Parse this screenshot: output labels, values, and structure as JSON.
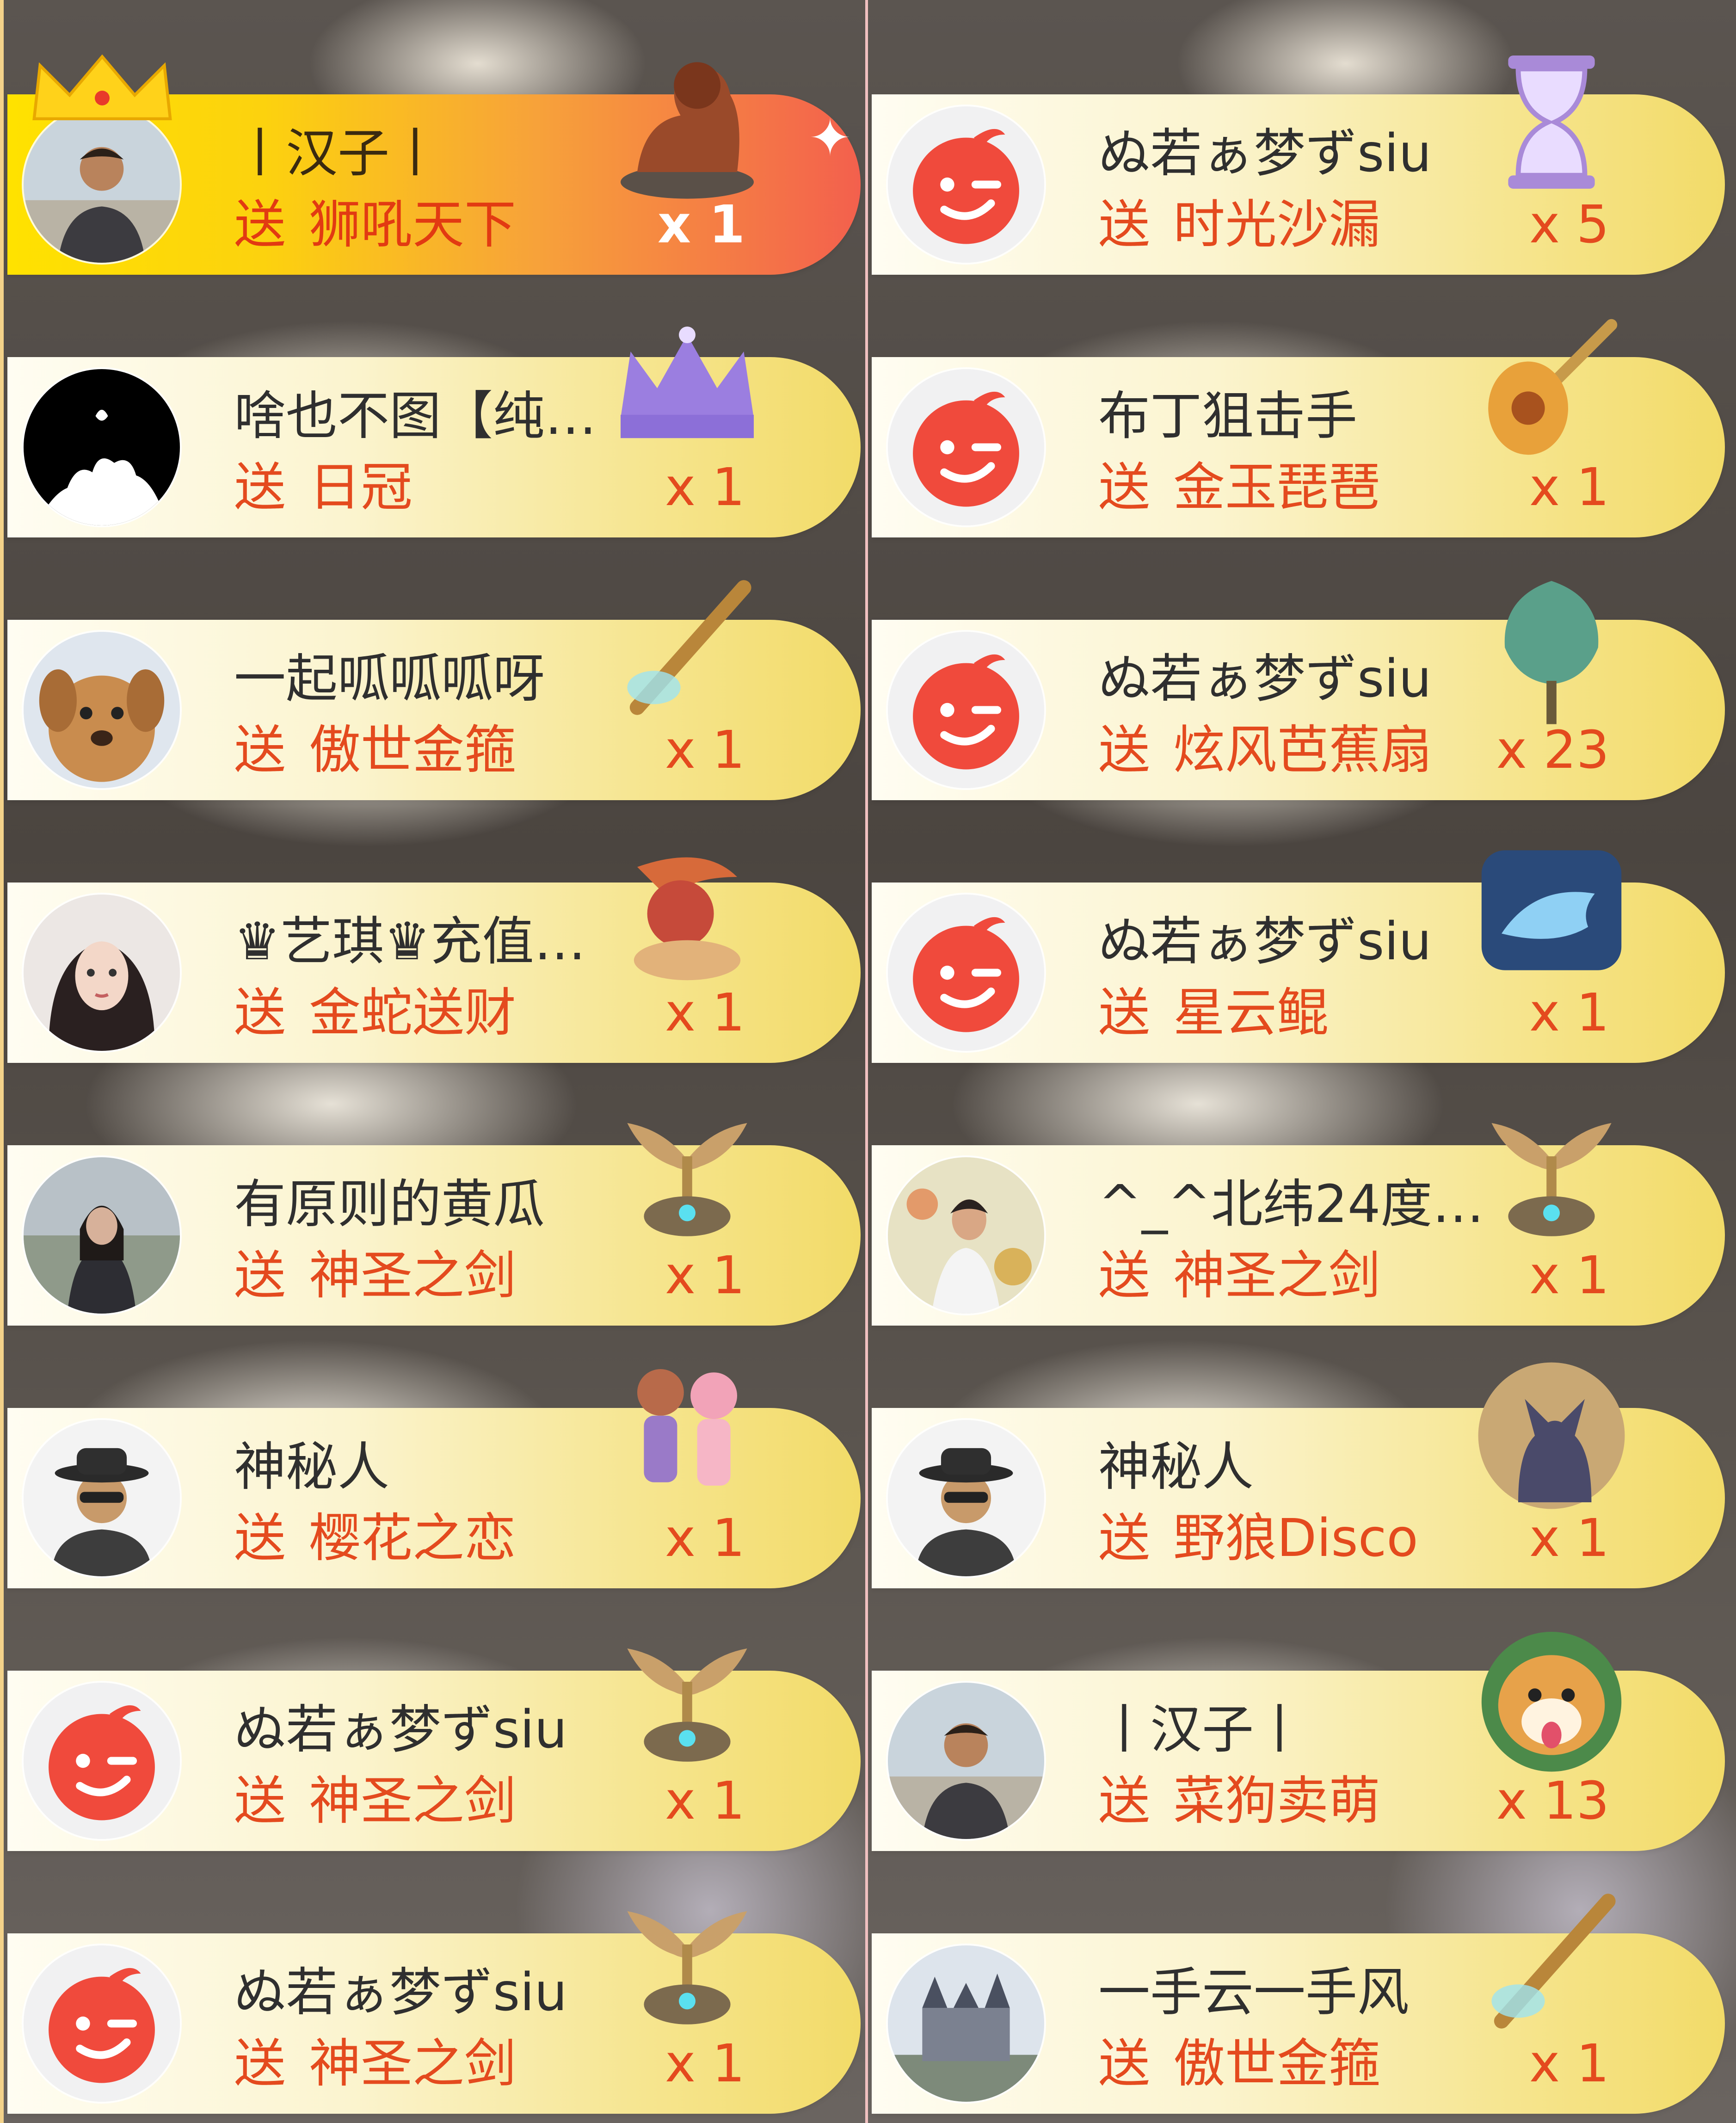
{
  "gift_feed": {
    "left_column": [
      {
        "username": "丨汉子丨",
        "send_label": "送",
        "gift": "狮吼天下",
        "count": "x 1",
        "avatar_icon": "man-photo-avatar",
        "gift_icon": "lion-statue-gift-icon",
        "highlight": true
      },
      {
        "username": "啥也不图【纯…",
        "send_label": "送",
        "gift": "日冠",
        "count": "x 1",
        "avatar_icon": "silhouette-avatar",
        "gift_icon": "crown-gift-icon"
      },
      {
        "username": "一起呱呱呱呀",
        "send_label": "送",
        "gift": "傲世金箍",
        "count": "x 1",
        "avatar_icon": "dog-avatar",
        "gift_icon": "golden-staff-gift-icon"
      },
      {
        "username": "♛艺琪♛充值…",
        "send_label": "送",
        "gift": "金蛇送财",
        "count": "x 1",
        "avatar_icon": "woman-portrait-avatar",
        "gift_icon": "golden-snake-gift-icon"
      },
      {
        "username": "有原则的黄瓜",
        "send_label": "送",
        "gift": "神圣之剑",
        "count": "x 1",
        "avatar_icon": "woman-photo-avatar",
        "gift_icon": "holy-sword-gift-icon"
      },
      {
        "username": "神秘人",
        "send_label": "送",
        "gift": "樱花之恋",
        "count": "x 1",
        "avatar_icon": "mystery-man-avatar",
        "gift_icon": "sakura-couple-gift-icon"
      },
      {
        "username": "ぬ若ぁ梦ずsiu",
        "send_label": "送",
        "gift": "神圣之剑",
        "count": "x 1",
        "avatar_icon": "red-wink-avatar",
        "gift_icon": "holy-sword-gift-icon"
      },
      {
        "username": "ぬ若ぁ梦ずsiu",
        "send_label": "送",
        "gift": "神圣之剑",
        "count": "x 1",
        "avatar_icon": "red-wink-avatar",
        "gift_icon": "holy-sword-gift-icon"
      }
    ],
    "right_column": [
      {
        "username": "ぬ若ぁ梦ずsiu",
        "send_label": "送",
        "gift": "时光沙漏",
        "count": "x 5",
        "avatar_icon": "red-wink-avatar",
        "gift_icon": "hourglass-gift-icon"
      },
      {
        "username": "布丁狙击手",
        "send_label": "送",
        "gift": "金玉琵琶",
        "count": "x 1",
        "avatar_icon": "red-wink-avatar",
        "gift_icon": "pipa-gift-icon"
      },
      {
        "username": "ぬ若ぁ梦ずsiu",
        "send_label": "送",
        "gift": "炫风芭蕉扇",
        "count": "x 23",
        "avatar_icon": "red-wink-avatar",
        "gift_icon": "banana-fan-gift-icon"
      },
      {
        "username": "ぬ若ぁ梦ずsiu",
        "send_label": "送",
        "gift": "星云鲲",
        "count": "x 1",
        "avatar_icon": "red-wink-avatar",
        "gift_icon": "nebula-whale-gift-icon"
      },
      {
        "username": "^_^北纬24度…",
        "send_label": "送",
        "gift": "神圣之剑",
        "count": "x 1",
        "avatar_icon": "woman-flowers-avatar",
        "gift_icon": "holy-sword-gift-icon"
      },
      {
        "username": "神秘人",
        "send_label": "送",
        "gift": "野狼Disco",
        "count": "x 1",
        "avatar_icon": "mystery-man-avatar",
        "gift_icon": "wolf-gift-icon"
      },
      {
        "username": "丨汉子丨",
        "send_label": "送",
        "gift": "菜狗卖萌",
        "count": "x 13",
        "avatar_icon": "man-photo-avatar",
        "gift_icon": "shiba-dog-gift-icon"
      },
      {
        "username": "一手云一手风",
        "send_label": "送",
        "gift": "傲世金箍",
        "count": "x 1",
        "avatar_icon": "castle-avatar",
        "gift_icon": "golden-staff-gift-icon"
      }
    ]
  },
  "colors": {
    "gift_text": "#e44a1e",
    "username_text": "#2f2f2f",
    "card_gold": "#f2db68",
    "highlight_start": "#ffe200",
    "highlight_end": "#f3604d",
    "avatar_red": "#f04a3c"
  }
}
